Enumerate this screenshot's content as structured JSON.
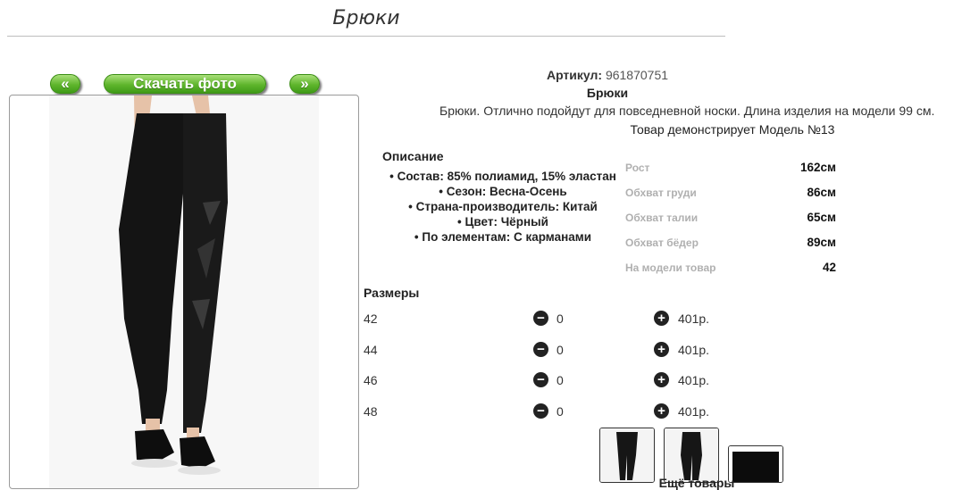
{
  "page": {
    "title": "Брюки"
  },
  "gallery": {
    "prev_label": "«",
    "download_label": "Скачать фото",
    "next_label": "»"
  },
  "product": {
    "article_label": "Артикул:",
    "article_value": "961870751",
    "name": "Брюки",
    "description": "Брюки. Отлично подойдут для повседневной носки. Длина изделия на модели 99 см.",
    "model_line": "Товар демонстрирует Модель №13"
  },
  "specs": {
    "title": "Описание",
    "items": [
      "Состав: 85% полиамид, 15% эластан",
      "Сезон: Весна-Осень",
      "Страна-производитель: Китай",
      "Цвет: Чёрный",
      "По элементам: С карманами"
    ]
  },
  "model_params": [
    {
      "label": "Рост",
      "value": "162см"
    },
    {
      "label": "Обхват груди",
      "value": "86см"
    },
    {
      "label": "Обхват талии",
      "value": "65см"
    },
    {
      "label": "Обхват бёдер",
      "value": "89см"
    },
    {
      "label": "На модели товар",
      "value": "42"
    }
  ],
  "sizes": {
    "title": "Размеры",
    "minus_symbol": "−",
    "plus_symbol": "+",
    "rows": [
      {
        "size": "42",
        "qty": "0",
        "price": "401р."
      },
      {
        "size": "44",
        "qty": "0",
        "price": "401р."
      },
      {
        "size": "46",
        "qty": "0",
        "price": "401р."
      },
      {
        "size": "48",
        "qty": "0",
        "price": "401р."
      }
    ]
  },
  "more_label": "Ещё товары",
  "colors": {
    "accent_green": "#5fb52c",
    "garment_black": "#141414"
  }
}
